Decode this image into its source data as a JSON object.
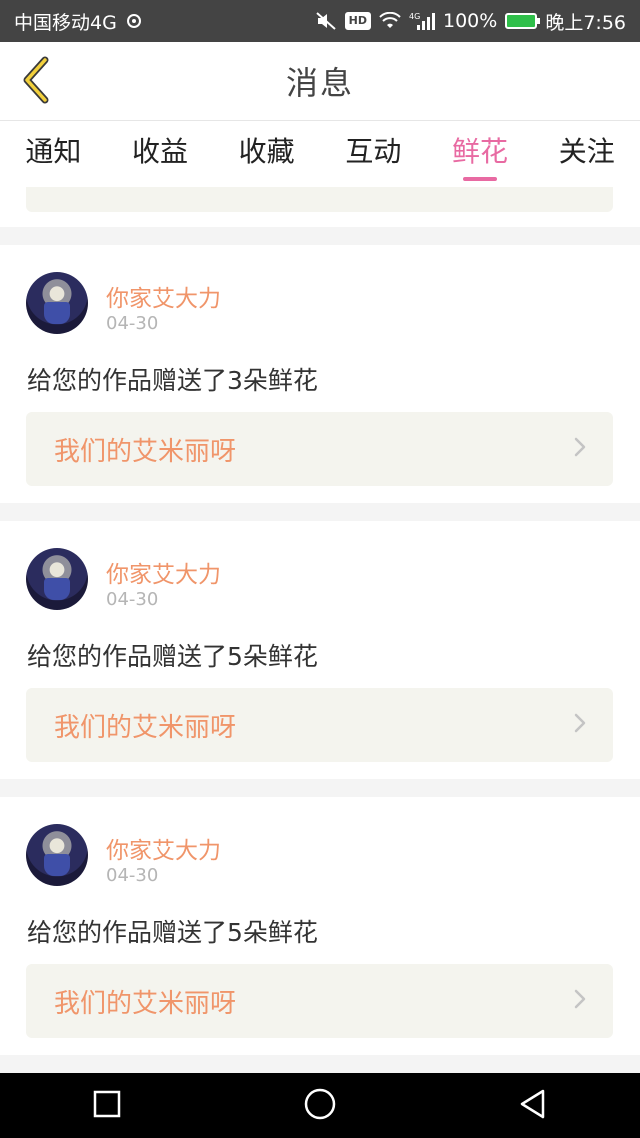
{
  "status_bar": {
    "carrier": "中国移动4G",
    "network_small": "4G",
    "battery": "100%",
    "time": "晚上7:56"
  },
  "header": {
    "title": "消息"
  },
  "tabs": [
    {
      "label": "通知"
    },
    {
      "label": "收益"
    },
    {
      "label": "收藏"
    },
    {
      "label": "互动"
    },
    {
      "label": "鲜花",
      "active": true
    },
    {
      "label": "关注"
    }
  ],
  "colors": {
    "accent": "#e86aa2",
    "name": "#f0956a",
    "link_bg": "#f4f4ee"
  },
  "messages": [
    {
      "user": "你家艾大力",
      "date": "04-30",
      "text": "给您的作品赠送了3朵鲜花",
      "work": "我们的艾米丽呀"
    },
    {
      "user": "你家艾大力",
      "date": "04-30",
      "text": "给您的作品赠送了5朵鲜花",
      "work": "我们的艾米丽呀"
    },
    {
      "user": "你家艾大力",
      "date": "04-30",
      "text": "给您的作品赠送了5朵鲜花",
      "work": "我们的艾米丽呀"
    }
  ],
  "icons": {
    "back": "chevron-left-icon",
    "work_arrow": "chevron-right-icon",
    "nav_recent": "square-icon",
    "nav_home": "circle-icon",
    "nav_back": "triangle-back-icon"
  }
}
